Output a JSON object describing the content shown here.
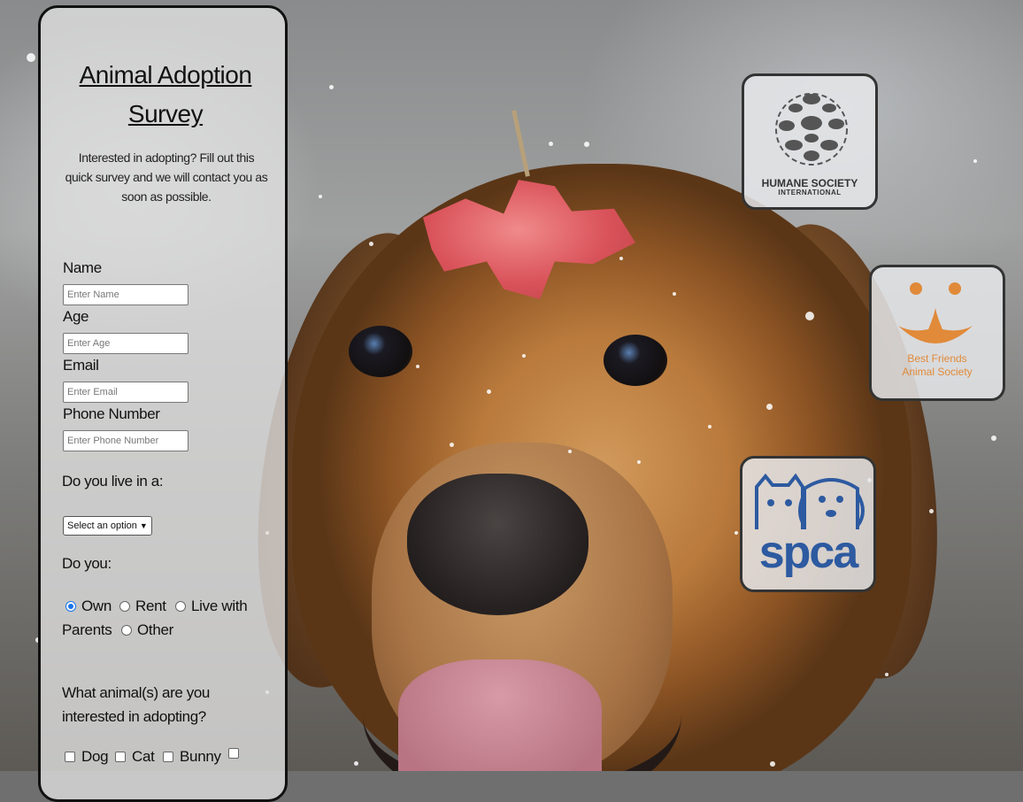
{
  "survey": {
    "title": "Animal Adoption Survey",
    "intro": "Interested in adopting? Fill out this quick survey and we will contact you as soon as possible.",
    "fields": [
      {
        "label": "Name",
        "placeholder": "Enter Name"
      },
      {
        "label": "Age",
        "placeholder": "Enter Age"
      },
      {
        "label": "Email",
        "placeholder": "Enter Email"
      },
      {
        "label": "Phone Number",
        "placeholder": "Enter Phone Number"
      }
    ],
    "residence": {
      "label": "Do you live in a:",
      "selected": "Select an option"
    },
    "ownership": {
      "label": "Do you:",
      "options": [
        "Own",
        "Rent",
        "Live with Parents",
        "Other"
      ],
      "selected": "Own"
    },
    "animals": {
      "label": "What animal(s) are you interested in adopting?",
      "options": [
        "Dog",
        "Cat",
        "Bunny"
      ]
    }
  },
  "logos": {
    "humane": {
      "line1": "HUMANE SOCIETY",
      "line2": "INTERNATIONAL",
      "icon": "animal-globe-icon"
    },
    "best_friends": {
      "line1": "Best Friends",
      "line2": "Animal Society",
      "icon": "smiling-face-icon"
    },
    "spca": {
      "text": "spca",
      "icon": "cat-dog-icon"
    }
  },
  "colors": {
    "radio_accent": "#1a73e8",
    "best_friends_orange": "#e08a3a",
    "spca_blue": "#2d5aa0"
  }
}
